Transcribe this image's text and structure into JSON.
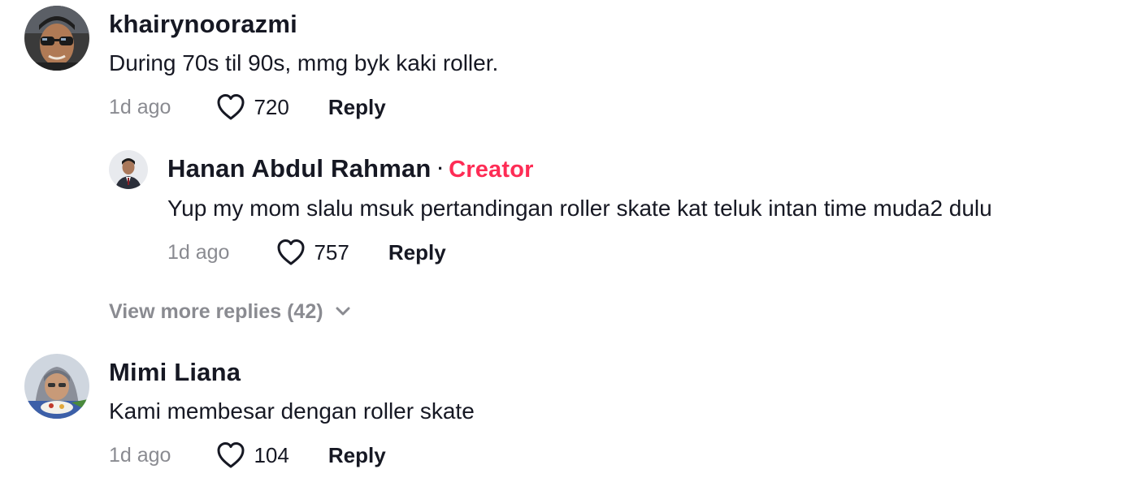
{
  "comments": [
    {
      "username": "khairynoorazmi",
      "text": "During 70s til 90s, mmg byk kaki roller.",
      "time": "1d ago",
      "likes": "720",
      "reply_label": "Reply",
      "avatar_icon": "avatar-photo-man-sunglasses"
    },
    {
      "username": "Mimi Liana",
      "text": "Kami membesar dengan roller skate",
      "time": "1d ago",
      "likes": "104",
      "reply_label": "Reply",
      "avatar_icon": "avatar-photo-woman-hijab"
    }
  ],
  "reply": {
    "username": "Hanan Abdul Rahman",
    "separator": "·",
    "creator_tag": "Creator",
    "text": "Yup my mom slalu msuk pertandingan roller skate kat teluk intan time muda2 dulu",
    "time": "1d ago",
    "likes": "757",
    "reply_label": "Reply",
    "avatar_icon": "avatar-photo-man-suit"
  },
  "view_more": {
    "label": "View more replies (42)",
    "icon": "chevron-down-icon"
  },
  "colors": {
    "creator_accent": "#fe2c55",
    "secondary_text": "#8a8b91",
    "primary_text": "#161823"
  }
}
